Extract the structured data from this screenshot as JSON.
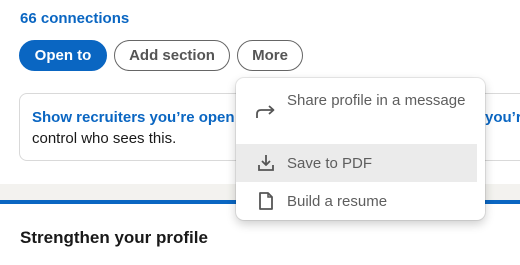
{
  "profile": {
    "connections": "66 connections"
  },
  "actions": {
    "open_to": "Open to",
    "add_section": "Add section",
    "more": "More"
  },
  "recruiter_card": {
    "title": "Show recruiters you’re open",
    "body": "control who sees this.",
    "title_tail": "you’r"
  },
  "more_menu": {
    "items": [
      {
        "label": "Share profile in a message",
        "icon": "share-arrow-icon"
      },
      {
        "label": "Save to PDF",
        "icon": "download-icon"
      },
      {
        "label": "Build a resume",
        "icon": "document-icon"
      }
    ]
  },
  "section": {
    "title": "Strengthen your profile"
  },
  "colors": {
    "brand_blue": "#0a66c2",
    "background_grey": "#f3f2ef"
  }
}
